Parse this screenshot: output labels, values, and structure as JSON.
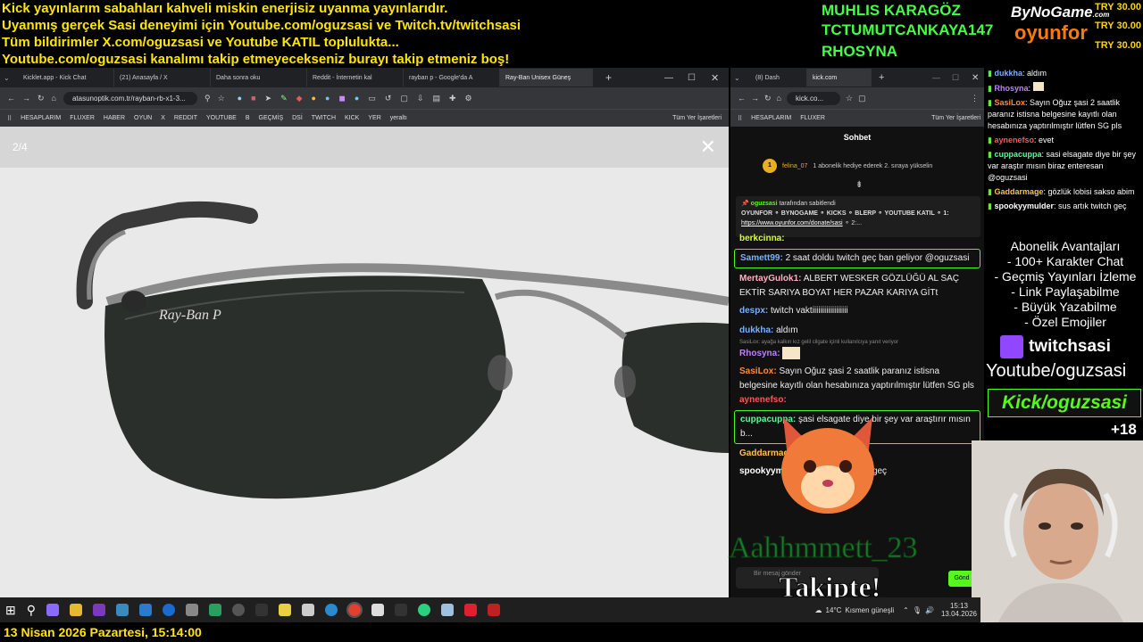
{
  "overlay_top": {
    "lines": [
      "Kick yayınlarım sabahları kahveli miskin enerjisiz uyanma yayınlarıdır.",
      "Uyanmış gerçek Sasi deneyimi için Youtube.com/oguzsasi ve Twitch.tv/twitchsasi",
      "Tüm bildirimler X.com/oguzsasi ve Youtube KATIL toplulukta...",
      "Youtube.com/oguzsasi kanalımı takip etmeyecekseniz burayı takip etmeniz boş!"
    ],
    "donors": [
      "MUHLIS KARAGÖZ",
      "TCTUMUTCANKAYA147",
      "RHOSYNA"
    ],
    "brand1": "ByNoGame",
    "brand1_sub": ".com",
    "brand2": "oyunfor",
    "try_amounts": [
      "TRY 30.00",
      "TRY 30.00",
      "TRY 30.00"
    ]
  },
  "left_browser": {
    "tabs": [
      "Kicklet.app - Kick Chat",
      "(21) Anasayfa / X",
      "Daha sonra oku",
      "Reddit - İnternetin kal",
      "rayban p - Google'da A",
      "Ray-Ban Unisex Güneş"
    ],
    "url": "atasunoptik.com.tr/rayban-rb-x1-3...",
    "bookmarks": [
      "HESAPLARIM",
      "FLUXER",
      "HABER",
      "OYUN",
      "X",
      "REDDIT",
      "YOUTUBE",
      "B",
      "GEÇMİŞ",
      "DSİ",
      "TWITCH",
      "KICK",
      "YER",
      "yeraltı",
      "Tüm Yer İşaretleri"
    ],
    "page_counter": "2/4",
    "lens_brand": "Ray-Ban P"
  },
  "right_browser": {
    "tabs": [
      "(8) Dash",
      "kick.com"
    ],
    "url": "kick.co...",
    "bookmarks": [
      "HESAPLARIM",
      "FLUXER",
      "Tüm Yer İşaretleri"
    ],
    "header": "Sohbet",
    "gifter": {
      "name": "felina_07",
      "rank": "1",
      "text": "1 abonelik hediye ederek 2. sıraya yükselin"
    },
    "pinned": {
      "by": "oguzsasi",
      "suffix": "tarafından sabitlendi",
      "text": "OYUNFOR ⚬ BYNOGAME ⚬ KICKS ⚬ BLERP ⚬ YOUTUBE KATIL ⚬ 1:",
      "link": "https://www.oyunfor.com/donate/sasi",
      "link_suffix": "⚬ 2:..."
    },
    "messages": [
      {
        "user": "berkcinna:",
        "text": "",
        "color": "#d9ff33"
      },
      {
        "user": "Samett99:",
        "text": "2 saat doldu twitch geç ban geliyor @oguzsasi",
        "color": "#7ab0ff",
        "highlight": true
      },
      {
        "user": "MertayGulok1:",
        "text": "ALBERT WESKER GÖZLÜĞÜ AL SAÇ EKTİR SARIYA BOYAT HER PAZAR KARIYA GİTt",
        "color": "#ffb0c0"
      },
      {
        "user": "despx:",
        "text": "twitch vaktiiiiiiiiiiiiiiiiii",
        "color": "#7ab0ff"
      },
      {
        "user": "dukkha:",
        "text": "aldım",
        "color": "#7ab0ff"
      },
      {
        "user": "Rhosyna:",
        "text": "",
        "color": "#c080ff"
      },
      {
        "user": "SasiLox:",
        "text": "Sayın Oğuz şasi 2 saatlik paranız istisna belgesine kayıtlı olan hesabınıza yaptırılmıştır lütfen SG pls",
        "color": "#ff8c3a"
      },
      {
        "user": "aynenefso:",
        "text": "",
        "color": "#ff5555"
      },
      {
        "user": "cuppacuppa:",
        "text": "şasi elsagate diye bir şey var araştırır mısın b...",
        "color": "#55ff99",
        "highlight": true
      },
      {
        "user": "Gaddarmage:",
        "text": "abim",
        "color": "#ffc04d"
      },
      {
        "user": "spookyymulder:",
        "text": "sus artık twitch geç",
        "color": "#ffffff"
      }
    ],
    "reply_hint": "SasiLox: ayağa kalkın kız gelil cilgate içinli kullanılcıya yanıt veriyor",
    "input_placeholder": "Bir mesaj gönder",
    "send": "Gönd"
  },
  "follower_alert": {
    "name": "Aahhmmett_23",
    "text": "Takipte!"
  },
  "overlay_chat": [
    {
      "user": "dukkha",
      "text": ": aldım",
      "color": "#7ab0ff"
    },
    {
      "user": "Rhosyna",
      "text": ":",
      "color": "#c080ff"
    },
    {
      "user": "SasiLox",
      "text": ": Sayın Oğuz şasi 2 saatlik paranız istisna belgesine kayıtlı olan hesabınıza yaptırılmıştır lütfen SG pls",
      "color": "#ff8c3a"
    },
    {
      "user": "aynenefso",
      "text": ": evet",
      "color": "#ff5555"
    },
    {
      "user": "cuppacuppa",
      "text": ": sasi elsagate diye bir şey var araştır mısın biraz enteresan @oguzsasi",
      "color": "#55ff99"
    },
    {
      "user": "Gaddarmage",
      "text": ": gözlük lobisi sakso abim",
      "color": "#ffc04d"
    },
    {
      "user": "spookyymulder",
      "text": ": sus artık twitch geç",
      "color": "#ffffff"
    }
  ],
  "perks": {
    "title": "Abonelik Avantajları",
    "items": [
      "- 100+ Karakter Chat",
      "- Geçmiş Yayınları İzleme",
      "- Link Paylaşabilme",
      "- Büyük Yazabilme",
      "- Özel Emojiler"
    ]
  },
  "socials": {
    "twitch": "twitchsasi",
    "youtube": "Youtube/oguzsasi",
    "kick": "Kick/oguzsasi",
    "count": "+18"
  },
  "taskbar": {
    "weather": "14°C",
    "weather_desc": "Kısmen güneşli",
    "time": "15:13",
    "date": "13.04.2026"
  },
  "footer": {
    "datetime": "13 Nisan 2026 Pazartesi, 15:14:00"
  },
  "colors": {
    "ticker": "#ffe600",
    "donor": "#44ff44",
    "kick": "#53fc18"
  }
}
